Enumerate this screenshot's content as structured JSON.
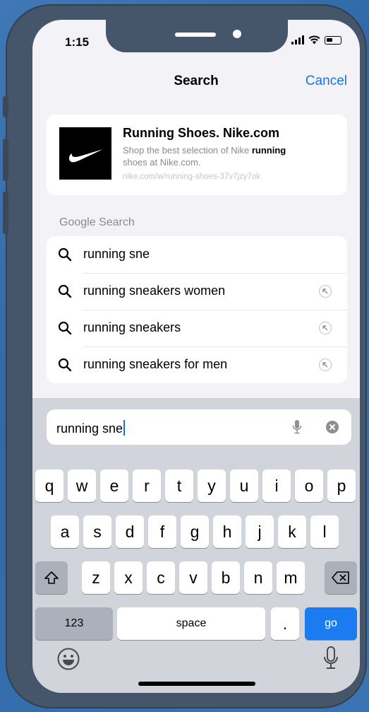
{
  "status_bar": {
    "time": "1:15"
  },
  "nav": {
    "title": "Search",
    "cancel_label": "Cancel"
  },
  "top_hit": {
    "title": "Running Shoes. Nike.com",
    "desc_before": "Shop the best selection of Nike ",
    "desc_bold": "running",
    "desc_after": "shoes at Nike.com.",
    "url": "nike.com/w/running-shoes-37v7jzy7ok"
  },
  "section_label": "Google Search",
  "suggestions": [
    {
      "text": "running sne",
      "has_fill": false
    },
    {
      "text": "running sneakers women",
      "has_fill": true
    },
    {
      "text": "running sneakers",
      "has_fill": true
    },
    {
      "text": "running sneakers for men",
      "has_fill": true
    }
  ],
  "url_field": {
    "value": "running sne"
  },
  "keyboard": {
    "row1": [
      "q",
      "w",
      "e",
      "r",
      "t",
      "y",
      "u",
      "i",
      "o",
      "p"
    ],
    "row2": [
      "a",
      "s",
      "d",
      "f",
      "g",
      "h",
      "j",
      "k",
      "l"
    ],
    "row3": [
      "z",
      "x",
      "c",
      "v",
      "b",
      "n",
      "m"
    ],
    "numbers_label": "123",
    "space_label": "space",
    "period_label": ".",
    "go_label": "go"
  },
  "colors": {
    "accent": "#1a73e8",
    "go_key": "#1a7cf0",
    "keyboard_bg": "#d1d4db"
  },
  "icons": [
    "search-icon",
    "fill-arrow-icon",
    "microphone-icon",
    "clear-icon",
    "shift-icon",
    "backspace-icon",
    "emoji-icon",
    "dictation-icon",
    "nike-swoosh-logo"
  ]
}
